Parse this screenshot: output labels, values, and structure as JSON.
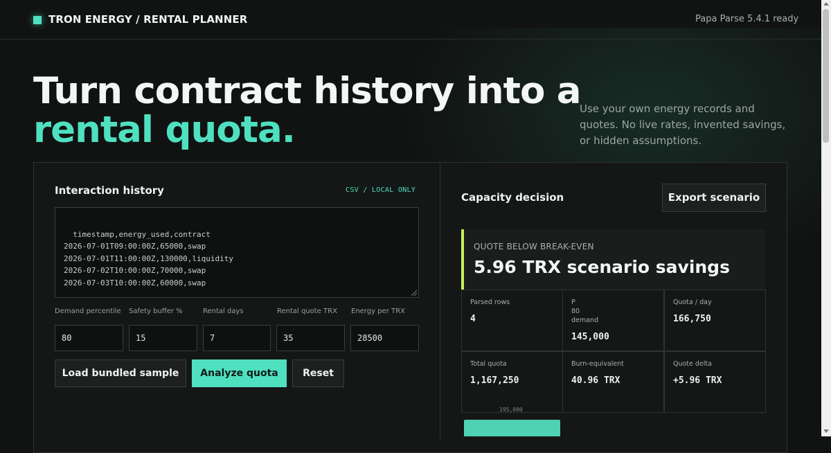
{
  "header": {
    "title": "TRON ENERGY / RENTAL PLANNER",
    "status": "Papa Parse 5.4.1 ready"
  },
  "hero": {
    "title_line1": "Turn contract history into a",
    "title_line2": "rental quota.",
    "description": "Use your own energy records and quotes. No live rates, invented savings, or hidden assumptions."
  },
  "history": {
    "title": "Interaction history",
    "tag": "CSV / LOCAL ONLY",
    "csv": "timestamp,energy_used,contract\n2026-07-01T09:00:00Z,65000,swap\n2026-07-01T11:00:00Z,130000,liquidity\n2026-07-02T10:00:00Z,70000,swap\n2026-07-03T10:00:00Z,60000,swap"
  },
  "inputs": [
    {
      "label": "Demand percentile",
      "value": "80"
    },
    {
      "label": "Safety buffer %",
      "value": "15"
    },
    {
      "label": "Rental days",
      "value": "7"
    },
    {
      "label": "Rental quote TRX",
      "value": "35"
    },
    {
      "label": "Energy per TRX",
      "value": "28500"
    }
  ],
  "buttons": {
    "load_sample": "Load bundled sample",
    "analyze": "Analyze quota",
    "reset": "Reset"
  },
  "decision": {
    "title": "Capacity decision",
    "export": "Export scenario",
    "callout_label": "QUOTE BELOW BREAK-EVEN",
    "callout_value": "5.96 TRX scenario savings",
    "accent_color": "#c5f05a"
  },
  "stats": {
    "parsed_rows": {
      "label": "Parsed rows",
      "value": "4"
    },
    "p80": {
      "label_p": "P",
      "label_num": "80",
      "label_word": "demand",
      "value": "145,000"
    },
    "quota_day": {
      "label": "Quota / day",
      "value": "166,750"
    },
    "total_quota": {
      "label": "Total quota",
      "value": "1,167,250"
    },
    "burn_equiv": {
      "label": "Burn-equivalent",
      "value": "40.96 TRX"
    },
    "quote_delta": {
      "label": "Quote delta",
      "value": "+5.96 TRX"
    }
  },
  "chart_data": {
    "type": "bar",
    "tick_label": "195,000",
    "categories": [
      ""
    ],
    "values": [
      195000
    ]
  },
  "colors": {
    "accent": "#4fe0c0",
    "background": "#111312"
  }
}
